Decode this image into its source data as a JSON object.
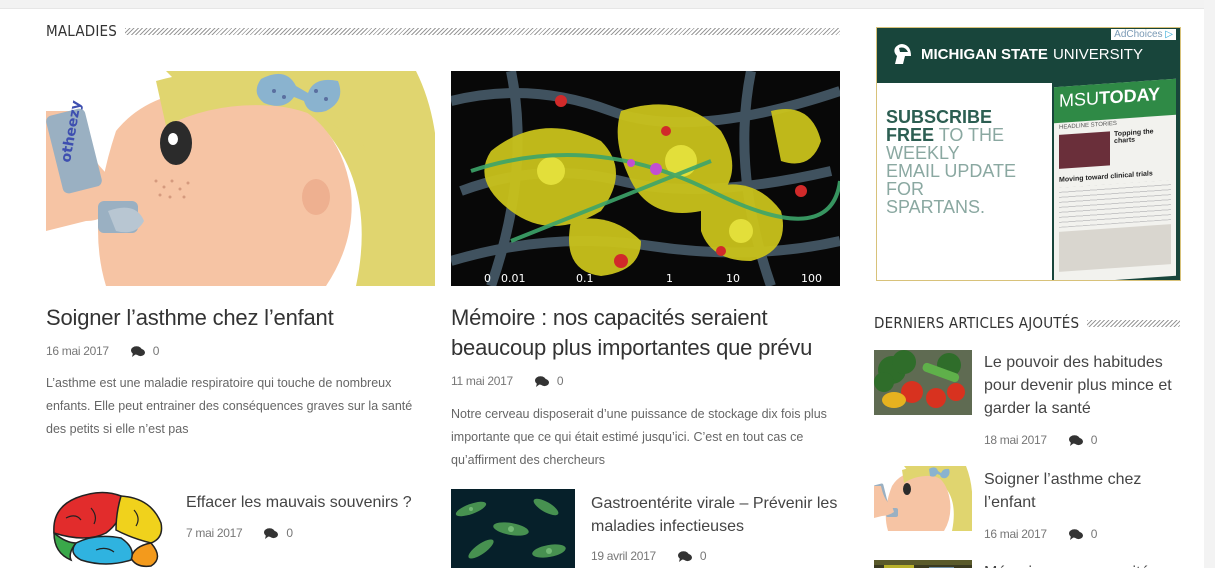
{
  "sections": {
    "maladies": "MALADIES",
    "recent": "DERNIERS ARTICLES AJOUTÉS"
  },
  "featured": [
    {
      "title": "Soigner l’asthme chez l’enfant",
      "date": "16 mai 2017",
      "comments": "0",
      "excerpt": "L’asthme est une maladie respiratoire qui touche de nombreux enfants. Elle peut entrainer des conséquences graves sur la santé des petits si elle n’est pas",
      "image_label": "otheezy"
    },
    {
      "title": "Mémoire : nos capacités seraient beaucoup plus importantes que prévu",
      "date": "11 mai 2017",
      "comments": "0",
      "excerpt": "Notre cerveau disposerait d’une puissance de stockage dix fois plus importante que ce qui était estimé jusqu’ici. C’est en tout cas ce qu’affirment des chercheurs",
      "scale": [
        "0",
        "0.01",
        "0.1",
        "1",
        "10",
        "100"
      ]
    }
  ],
  "small_articles": [
    {
      "title": "Effacer les mauvais souvenirs ?",
      "date": "7 mai 2017",
      "comments": "0"
    },
    {
      "title": "Gastroentérite virale – Prévenir les maladies infectieuses",
      "date": "19 avril 2017",
      "comments": "0"
    }
  ],
  "ad": {
    "choices": "AdChoices",
    "university_bold": "MICHIGAN STATE",
    "university_light": "UNIVERSITY",
    "line1_bold": "SUBSCRIBE",
    "line2_bold": "FREE",
    "line2_light": "TO THE",
    "line3": "WEEKLY",
    "line4": "EMAIL UPDATE",
    "line5": "FOR",
    "line6": "SPARTANS.",
    "msu": "MSU",
    "today": "TODAY",
    "headline": "HEADLINE STORIES",
    "story1": "Topping the charts",
    "story2": "Moving toward clinical trials"
  },
  "recent": [
    {
      "title": "Le pouvoir des habitudes pour devenir plus mince et garder la santé",
      "date": "18 mai 2017",
      "comments": "0"
    },
    {
      "title": "Soigner l’asthme chez l’enfant",
      "date": "16 mai 2017",
      "comments": "0"
    },
    {
      "title": "Mémoire : nos capacités",
      "date": "",
      "comments": ""
    }
  ],
  "colors": {
    "msu_green": "#18453b",
    "ad_border": "#d8c27a",
    "accent_text": "#333333"
  }
}
